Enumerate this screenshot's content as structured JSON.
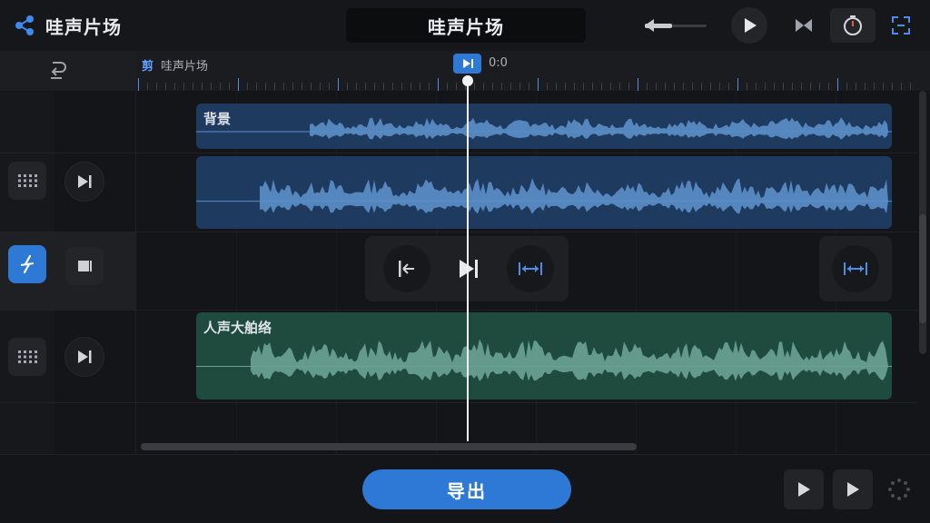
{
  "app": {
    "name": "哇声片场",
    "project_title": "哇声片场"
  },
  "icons": {
    "brand": "share-nodes-icon",
    "volume": "volume-slider-icon",
    "play": "play-icon",
    "bowtie": "bowtie-icon",
    "timer": "timer-icon",
    "expand": "expand-icon",
    "undo": "undo-icon",
    "grid": "grid-dots-icon",
    "skip": "skip-forward-icon",
    "stop": "stop-icon",
    "tempo": "tempo-icon",
    "split": "split-icon",
    "fit": "fit-width-icon",
    "loading": "loading-icon"
  },
  "ruler": {
    "cut_label": "剪",
    "project_label": "哇声片场",
    "playhead_time": "0:0"
  },
  "tracks": [
    {
      "label": "背景",
      "type": "audio",
      "color": "#1f3a5f"
    },
    {
      "label": "",
      "type": "audio",
      "color": "#1f3a5f"
    },
    {
      "label": "人声大舶络",
      "type": "voice",
      "color": "#1f4a3e"
    }
  ],
  "bottom": {
    "export_label": "导出"
  },
  "colors": {
    "accent": "#2f79d6",
    "wave_blue": "#5b8fc8",
    "wave_green": "#6aa394"
  }
}
